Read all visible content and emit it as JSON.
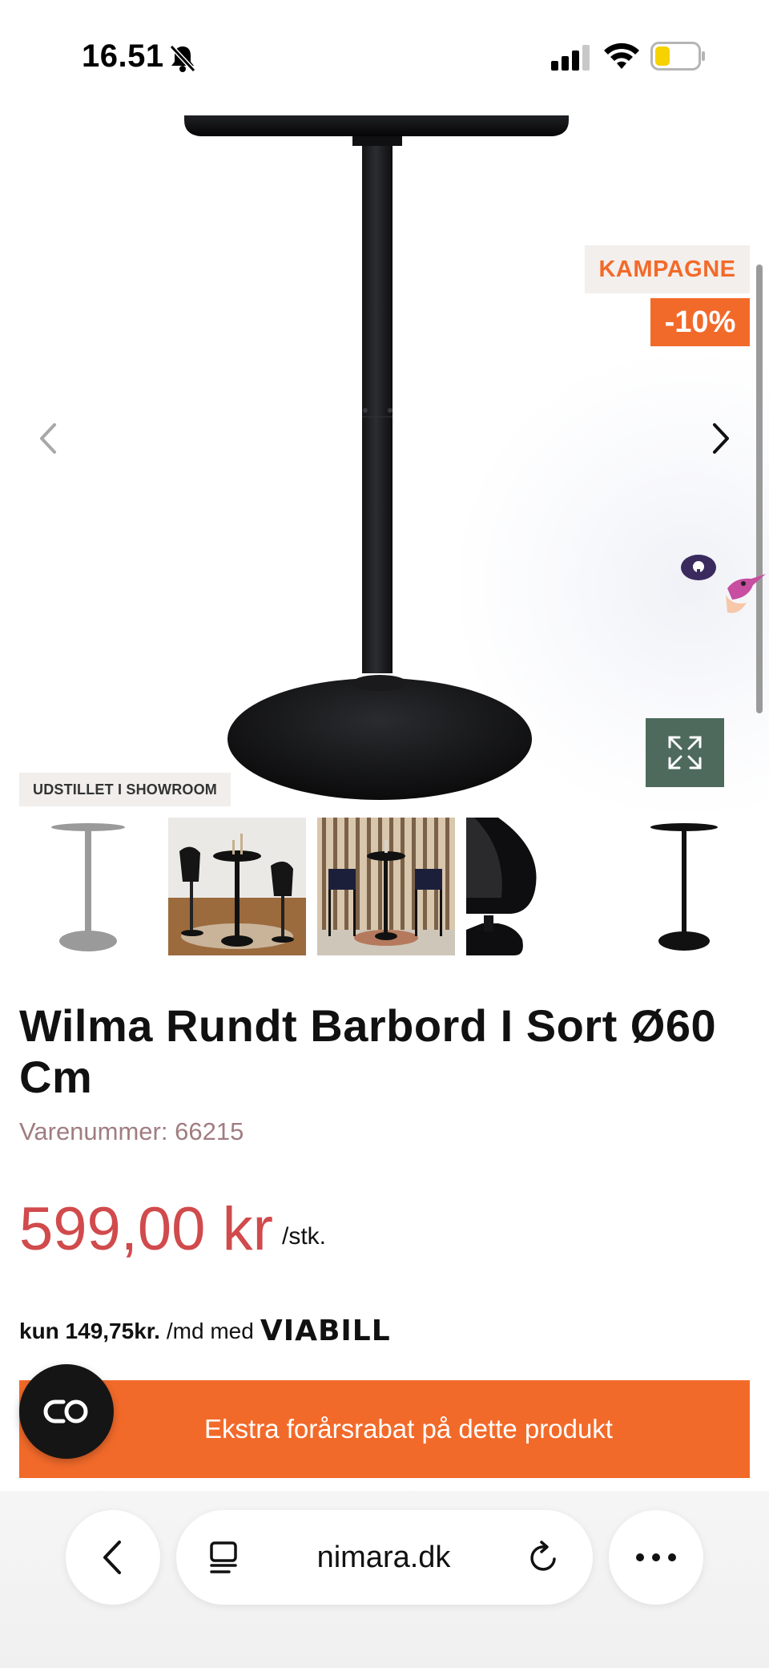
{
  "status_bar": {
    "time": "16.51"
  },
  "hero": {
    "badge_campaign": "KAMPAGNE",
    "badge_discount": "-10%",
    "badge_showroom": "UDSTILLET I SHOWROOM"
  },
  "product": {
    "title": "Wilma Rundt Barbord I Sort Ø60 Cm",
    "sku_label": "Varenummer:",
    "sku_value": "66215",
    "price": "599,00 kr",
    "unit": "/stk."
  },
  "financing": {
    "amount": "kun 149,75kr.",
    "suffix": "/md med",
    "provider": "VIABILL"
  },
  "promo": {
    "text": "Ekstra forårsrabat på dette produkt"
  },
  "browser": {
    "url": "nimara.dk"
  },
  "colors": {
    "accent_orange": "#f26a2a",
    "price_red": "#d14a4c",
    "expand_green": "#4d6a5d"
  },
  "icons": {
    "bell": "bell-slash-icon",
    "signal": "signal-icon",
    "wifi": "wifi-icon",
    "battery": "battery-icon",
    "prev": "chevron-left-icon",
    "next": "chevron-right-icon",
    "expand": "expand-icon",
    "loop": "loop-icon",
    "tabs": "tabs-icon",
    "reload": "reload-icon",
    "more": "more-icon"
  }
}
